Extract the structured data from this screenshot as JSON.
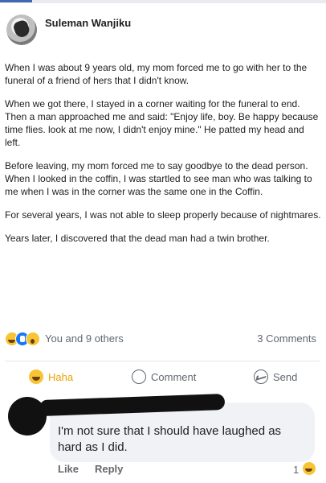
{
  "post": {
    "author": "Suleman Wanjiku",
    "paragraphs": [
      "When I was about 9 years old, my mom forced me to go with her to the funeral of a friend of hers that I didn't know.",
      "When we got there, I stayed in a corner waiting for the funeral to end. Then a man approached me and said: \"Enjoy life, boy. Be happy because time flies. look at me now, I didn't enjoy mine.\" He patted my head and left.",
      "Before leaving, my mom forced me to say goodbye to the dead person. When I looked in the coffin, I was startled to see man who was talking to me when I was in the corner was the same one in the Coffin.",
      "For several years, I was not able to sleep properly because of nightmares.",
      "Years later, I discovered that the dead man had a twin brother."
    ]
  },
  "reactions": {
    "icons": [
      "haha-icon",
      "like-icon",
      "wow-icon"
    ],
    "summary": "You and 9 others",
    "comments": "3 Comments"
  },
  "actions": {
    "haha": "Haha",
    "comment": "Comment",
    "send": "Send"
  },
  "comment": {
    "text": "I'm not sure that I should have laughed as hard as I did.",
    "like": "Like",
    "reply": "Reply",
    "reaction_count": "1"
  },
  "colors": {
    "haha_accent": "#e8a300",
    "like_blue": "#1877f2",
    "bubble_bg": "#f0f2f5"
  }
}
